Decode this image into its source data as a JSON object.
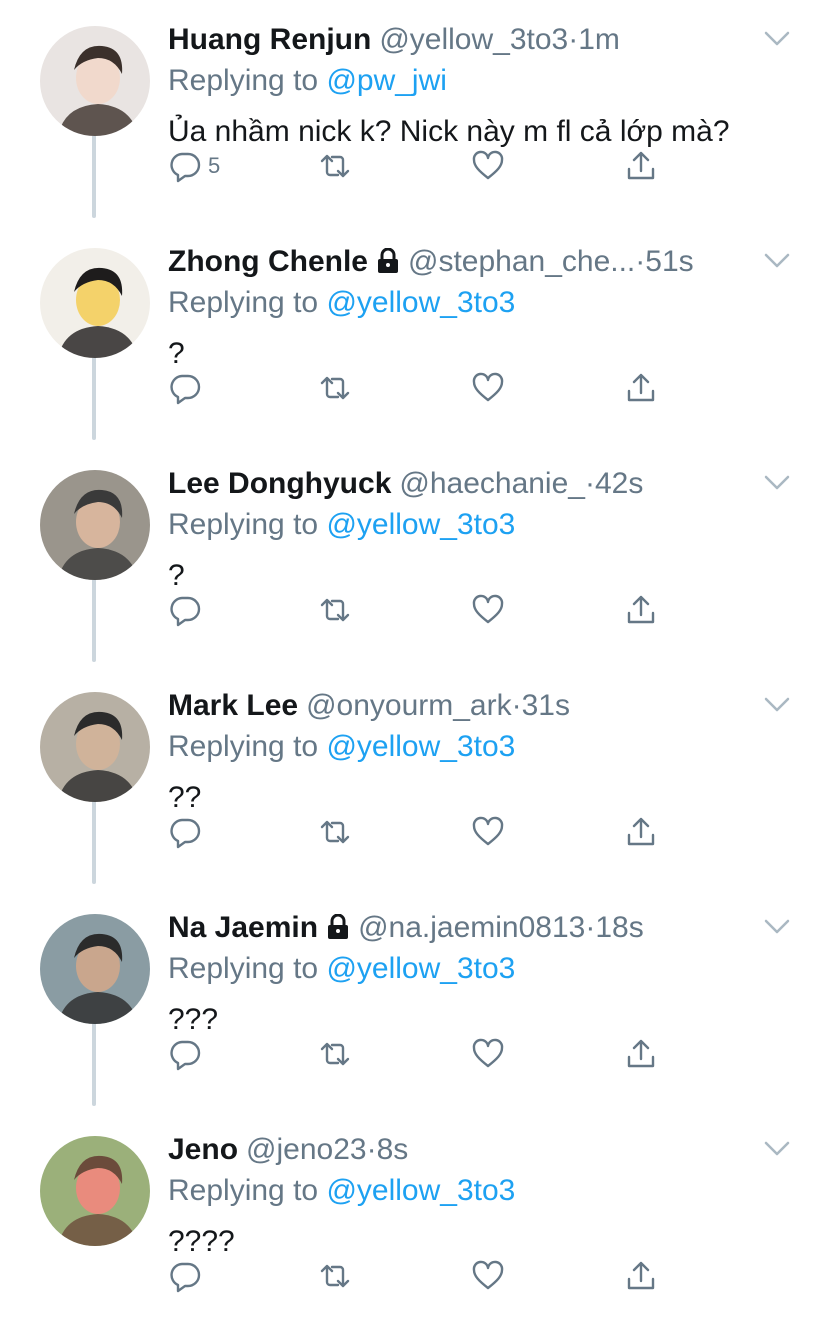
{
  "colors": {
    "accent": "#1da1f2",
    "secondary": "#657786",
    "thread_line": "#ccd6dd"
  },
  "tweets": [
    {
      "name": "Huang Renjun",
      "locked": false,
      "handle": "@yellow_3to3",
      "dot": "·",
      "time": "1m",
      "replying_label": "Replying to",
      "replying_to": "@pw_jwi",
      "text": "Ủa nhầm nick k? Nick này m fl cả lớp mà?",
      "reply_count": "5"
    },
    {
      "name": "Zhong Chenle",
      "locked": true,
      "handle": "@stephan_che...",
      "dot": "·",
      "time": "51s",
      "replying_label": "Replying to",
      "replying_to": "@yellow_3to3",
      "text": "?",
      "reply_count": ""
    },
    {
      "name": "Lee Donghyuck",
      "locked": false,
      "handle": "@haechanie_",
      "dot": "·",
      "time": "42s",
      "replying_label": "Replying to",
      "replying_to": "@yellow_3to3",
      "text": "?",
      "reply_count": ""
    },
    {
      "name": "Mark Lee",
      "locked": false,
      "handle": "@onyourm_ark",
      "dot": "·",
      "time": "31s",
      "replying_label": "Replying to",
      "replying_to": "@yellow_3to3",
      "text": "??",
      "reply_count": ""
    },
    {
      "name": "Na Jaemin",
      "locked": true,
      "handle": "@na.jaemin0813",
      "dot": "·",
      "time": "18s",
      "replying_label": "Replying to",
      "replying_to": "@yellow_3to3",
      "text": "???",
      "reply_count": ""
    },
    {
      "name": "Jeno",
      "locked": false,
      "handle": "@jeno23",
      "dot": "·",
      "time": "8s",
      "replying_label": "Replying to",
      "replying_to": "@yellow_3to3",
      "text": "????",
      "reply_count": ""
    }
  ],
  "icons": {
    "reply": "reply-icon",
    "retweet": "retweet-icon",
    "like": "heart-icon",
    "share": "share-icon",
    "menu": "chevron-down-icon",
    "lock": "lock-icon"
  }
}
